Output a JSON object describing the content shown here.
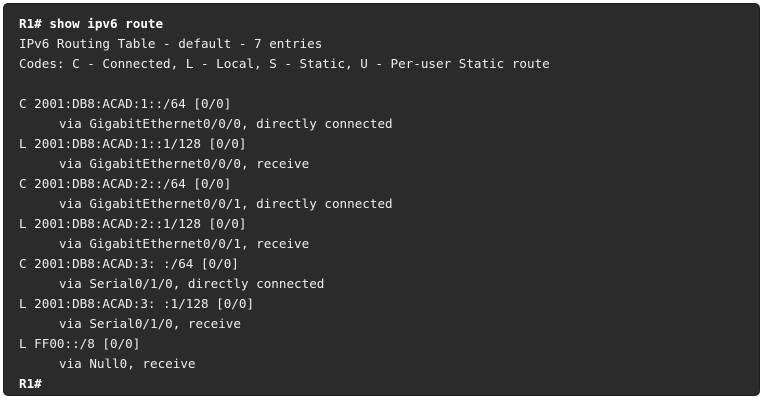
{
  "terminal": {
    "lines": [
      {
        "text": "R1# show ipv6 route",
        "bold": true
      },
      {
        "text": "IPv6 Routing Table - default - 7 entries"
      },
      {
        "text": "Codes: C - Connected, L - Local, S - Static, U - Per-user Static route"
      },
      {
        "text": ""
      },
      {
        "text": "C 2001:DB8:ACAD:1::/64 [0/0]"
      },
      {
        "text": "via GigabitEthernet0/0/0, directly connected",
        "indent": true
      },
      {
        "text": "L 2001:DB8:ACAD:1::1/128 [0/0]"
      },
      {
        "text": "via GigabitEthernet0/0/0, receive",
        "indent": true
      },
      {
        "text": "C 2001:DB8:ACAD:2::/64 [0/0]"
      },
      {
        "text": "via GigabitEthernet0/0/1, directly connected",
        "indent": true
      },
      {
        "text": "L 2001:DB8:ACAD:2::1/128 [0/0]"
      },
      {
        "text": "via GigabitEthernet0/0/1, receive",
        "indent": true
      },
      {
        "text": "C 2001:DB8:ACAD:3: :/64 [0/0]"
      },
      {
        "text": "via Serial0/1/0, directly connected",
        "indent": true
      },
      {
        "text": "L 2001:DB8:ACAD:3: :1/128 [0/0]"
      },
      {
        "text": "via Serial0/1/0, receive",
        "indent": true
      },
      {
        "text": "L FF00::/8 [0/0]"
      },
      {
        "text": "via Null0, receive",
        "indent": true
      },
      {
        "text": "R1#",
        "bold": true
      }
    ]
  }
}
